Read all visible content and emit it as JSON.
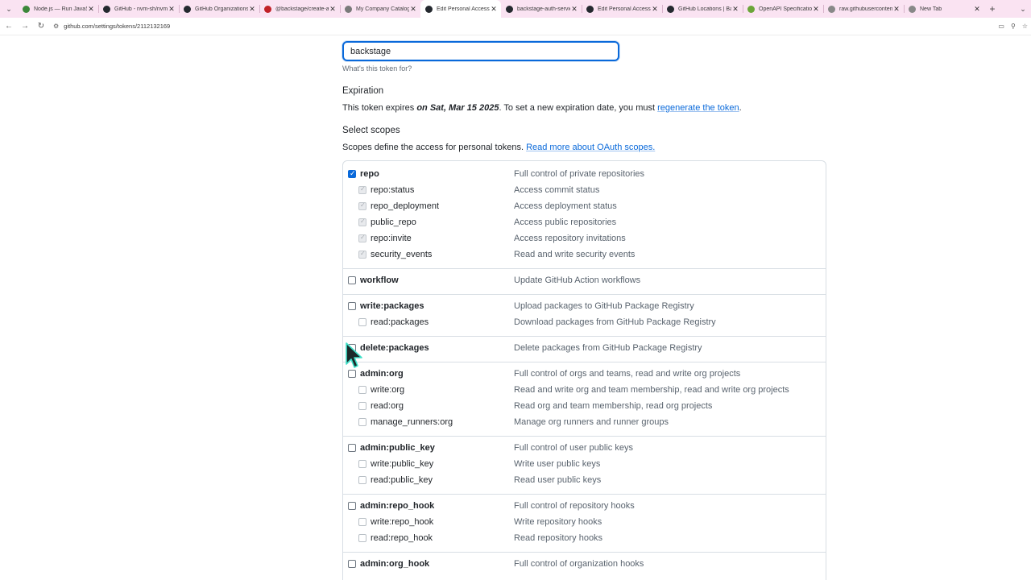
{
  "browser": {
    "tabs": [
      {
        "title": "Node.js — Run JavaSc",
        "color": "#3c873a",
        "glyph": "⬢"
      },
      {
        "title": "GitHub - nvm-sh/nvm:",
        "color": "#24292f",
        "glyph": "●"
      },
      {
        "title": "GitHub Organizations/",
        "color": "#24292f",
        "glyph": "●"
      },
      {
        "title": "@backstage/create-a",
        "color": "#c12127",
        "glyph": "■"
      },
      {
        "title": "My Company Catalog",
        "color": "#7a7a7a",
        "glyph": "▭"
      },
      {
        "title": "Edit Personal Access To",
        "color": "#24292f",
        "glyph": "●",
        "active": true
      },
      {
        "title": "backstage-auth-servic",
        "color": "#24292f",
        "glyph": "●"
      },
      {
        "title": "Edit Personal Access To",
        "color": "#24292f",
        "glyph": "●"
      },
      {
        "title": "GitHub Locations | Ba",
        "color": "#24292f",
        "glyph": "●"
      },
      {
        "title": "OpenAPI Specification",
        "color": "#6ba539",
        "glyph": "●"
      },
      {
        "title": "raw.githubuserconten",
        "color": "#888888",
        "glyph": "◎"
      },
      {
        "title": "New Tab",
        "color": "#888888",
        "glyph": "◎"
      }
    ],
    "new_tab": "+",
    "url": "github.com/settings/tokens/2112132169"
  },
  "token_form": {
    "note_value": "backstage",
    "note_help": "What's this token for?",
    "expiration_heading": "Expiration",
    "expiration_prefix": "This token expires ",
    "expiration_date": "on Sat, Mar 15 2025",
    "expiration_middle": ". To set a new expiration date, you must ",
    "regenerate_link": "regenerate the token",
    "expiration_suffix": ".",
    "scopes_heading": "Select scopes",
    "scopes_intro": "Scopes define the access for personal tokens. ",
    "scopes_link": "Read more about OAuth scopes."
  },
  "scopes": [
    {
      "name": "repo",
      "desc": "Full control of private repositories",
      "checked": true,
      "children": [
        {
          "name": "repo:status",
          "desc": "Access commit status"
        },
        {
          "name": "repo_deployment",
          "desc": "Access deployment status"
        },
        {
          "name": "public_repo",
          "desc": "Access public repositories"
        },
        {
          "name": "repo:invite",
          "desc": "Access repository invitations"
        },
        {
          "name": "security_events",
          "desc": "Read and write security events"
        }
      ]
    },
    {
      "name": "workflow",
      "desc": "Update GitHub Action workflows",
      "checked": false,
      "children": []
    },
    {
      "name": "write:packages",
      "desc": "Upload packages to GitHub Package Registry",
      "checked": false,
      "children": [
        {
          "name": "read:packages",
          "desc": "Download packages from GitHub Package Registry"
        }
      ]
    },
    {
      "name": "delete:packages",
      "desc": "Delete packages from GitHub Package Registry",
      "checked": false,
      "children": []
    },
    {
      "name": "admin:org",
      "desc": "Full control of orgs and teams, read and write org projects",
      "checked": false,
      "children": [
        {
          "name": "write:org",
          "desc": "Read and write org and team membership, read and write org projects"
        },
        {
          "name": "read:org",
          "desc": "Read org and team membership, read org projects"
        },
        {
          "name": "manage_runners:org",
          "desc": "Manage org runners and runner groups"
        }
      ]
    },
    {
      "name": "admin:public_key",
      "desc": "Full control of user public keys",
      "checked": false,
      "children": [
        {
          "name": "write:public_key",
          "desc": "Write user public keys"
        },
        {
          "name": "read:public_key",
          "desc": "Read user public keys"
        }
      ]
    },
    {
      "name": "admin:repo_hook",
      "desc": "Full control of repository hooks",
      "checked": false,
      "children": [
        {
          "name": "write:repo_hook",
          "desc": "Write repository hooks"
        },
        {
          "name": "read:repo_hook",
          "desc": "Read repository hooks"
        }
      ]
    },
    {
      "name": "admin:org_hook",
      "desc": "Full control of organization hooks",
      "checked": false,
      "children": []
    }
  ],
  "colors": {
    "accent": "#0969da",
    "tabbar": "#fae3f2"
  }
}
